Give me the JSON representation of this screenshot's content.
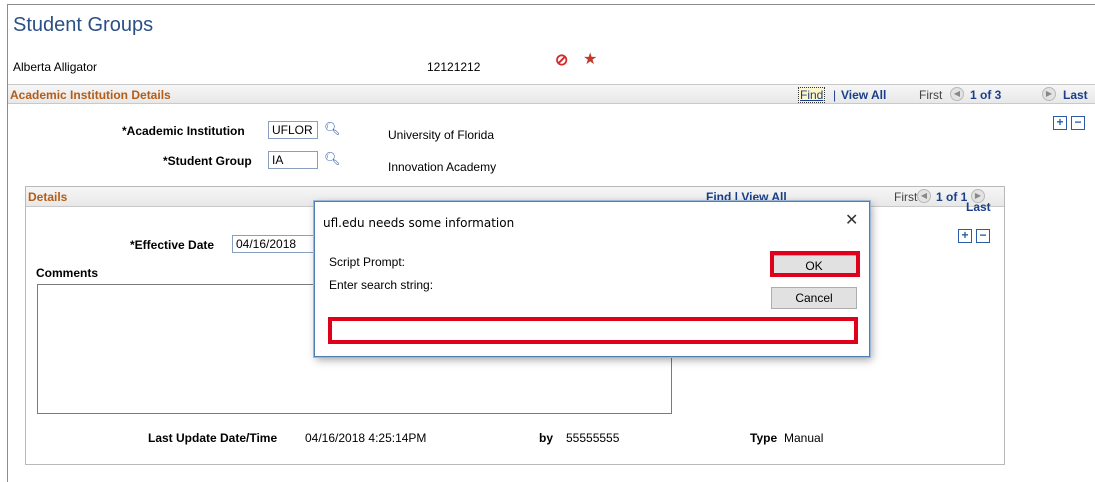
{
  "page": {
    "title": "Student Groups",
    "student_name": "Alberta Alligator",
    "emplid": "12121212",
    "no_icon": "⊘",
    "star_icon": "★"
  },
  "section": {
    "title": "Academic Institution Details",
    "find": "Find",
    "sep": "|",
    "view_all": "View All",
    "first": "First",
    "count": "1 of 3",
    "last": "Last",
    "add": "+",
    "remove": "−"
  },
  "fields": {
    "institution_label": "*Academic Institution",
    "institution_value": "UFLOR",
    "institution_desc": "University of Florida",
    "group_label": "*Student Group",
    "group_value": "IA",
    "group_desc": "Innovation Academy",
    "lookup_icon": "🔍︎"
  },
  "details": {
    "title": "Details",
    "find_partial": "Find | View All",
    "first_partial": "First",
    "count": "1 of 1",
    "last": "Last",
    "effective_label": "*Effective Date",
    "effective_value": "04/16/2018",
    "comments_label": "Comments",
    "last_update_label": "Last Update Date/Time",
    "last_update_value": "04/16/2018  4:25:14PM",
    "by_label": "by",
    "by_value": "55555555",
    "type_label": "Type",
    "type_value": "Manual",
    "add": "+",
    "remove": "−"
  },
  "dialog": {
    "title": "ufl.edu needs some information",
    "close": "✕",
    "prompt_label": "Script Prompt:",
    "message": "Enter search string:",
    "ok": "OK",
    "cancel": "Cancel",
    "input_value": "",
    "highlight_color": "#e0001b"
  }
}
